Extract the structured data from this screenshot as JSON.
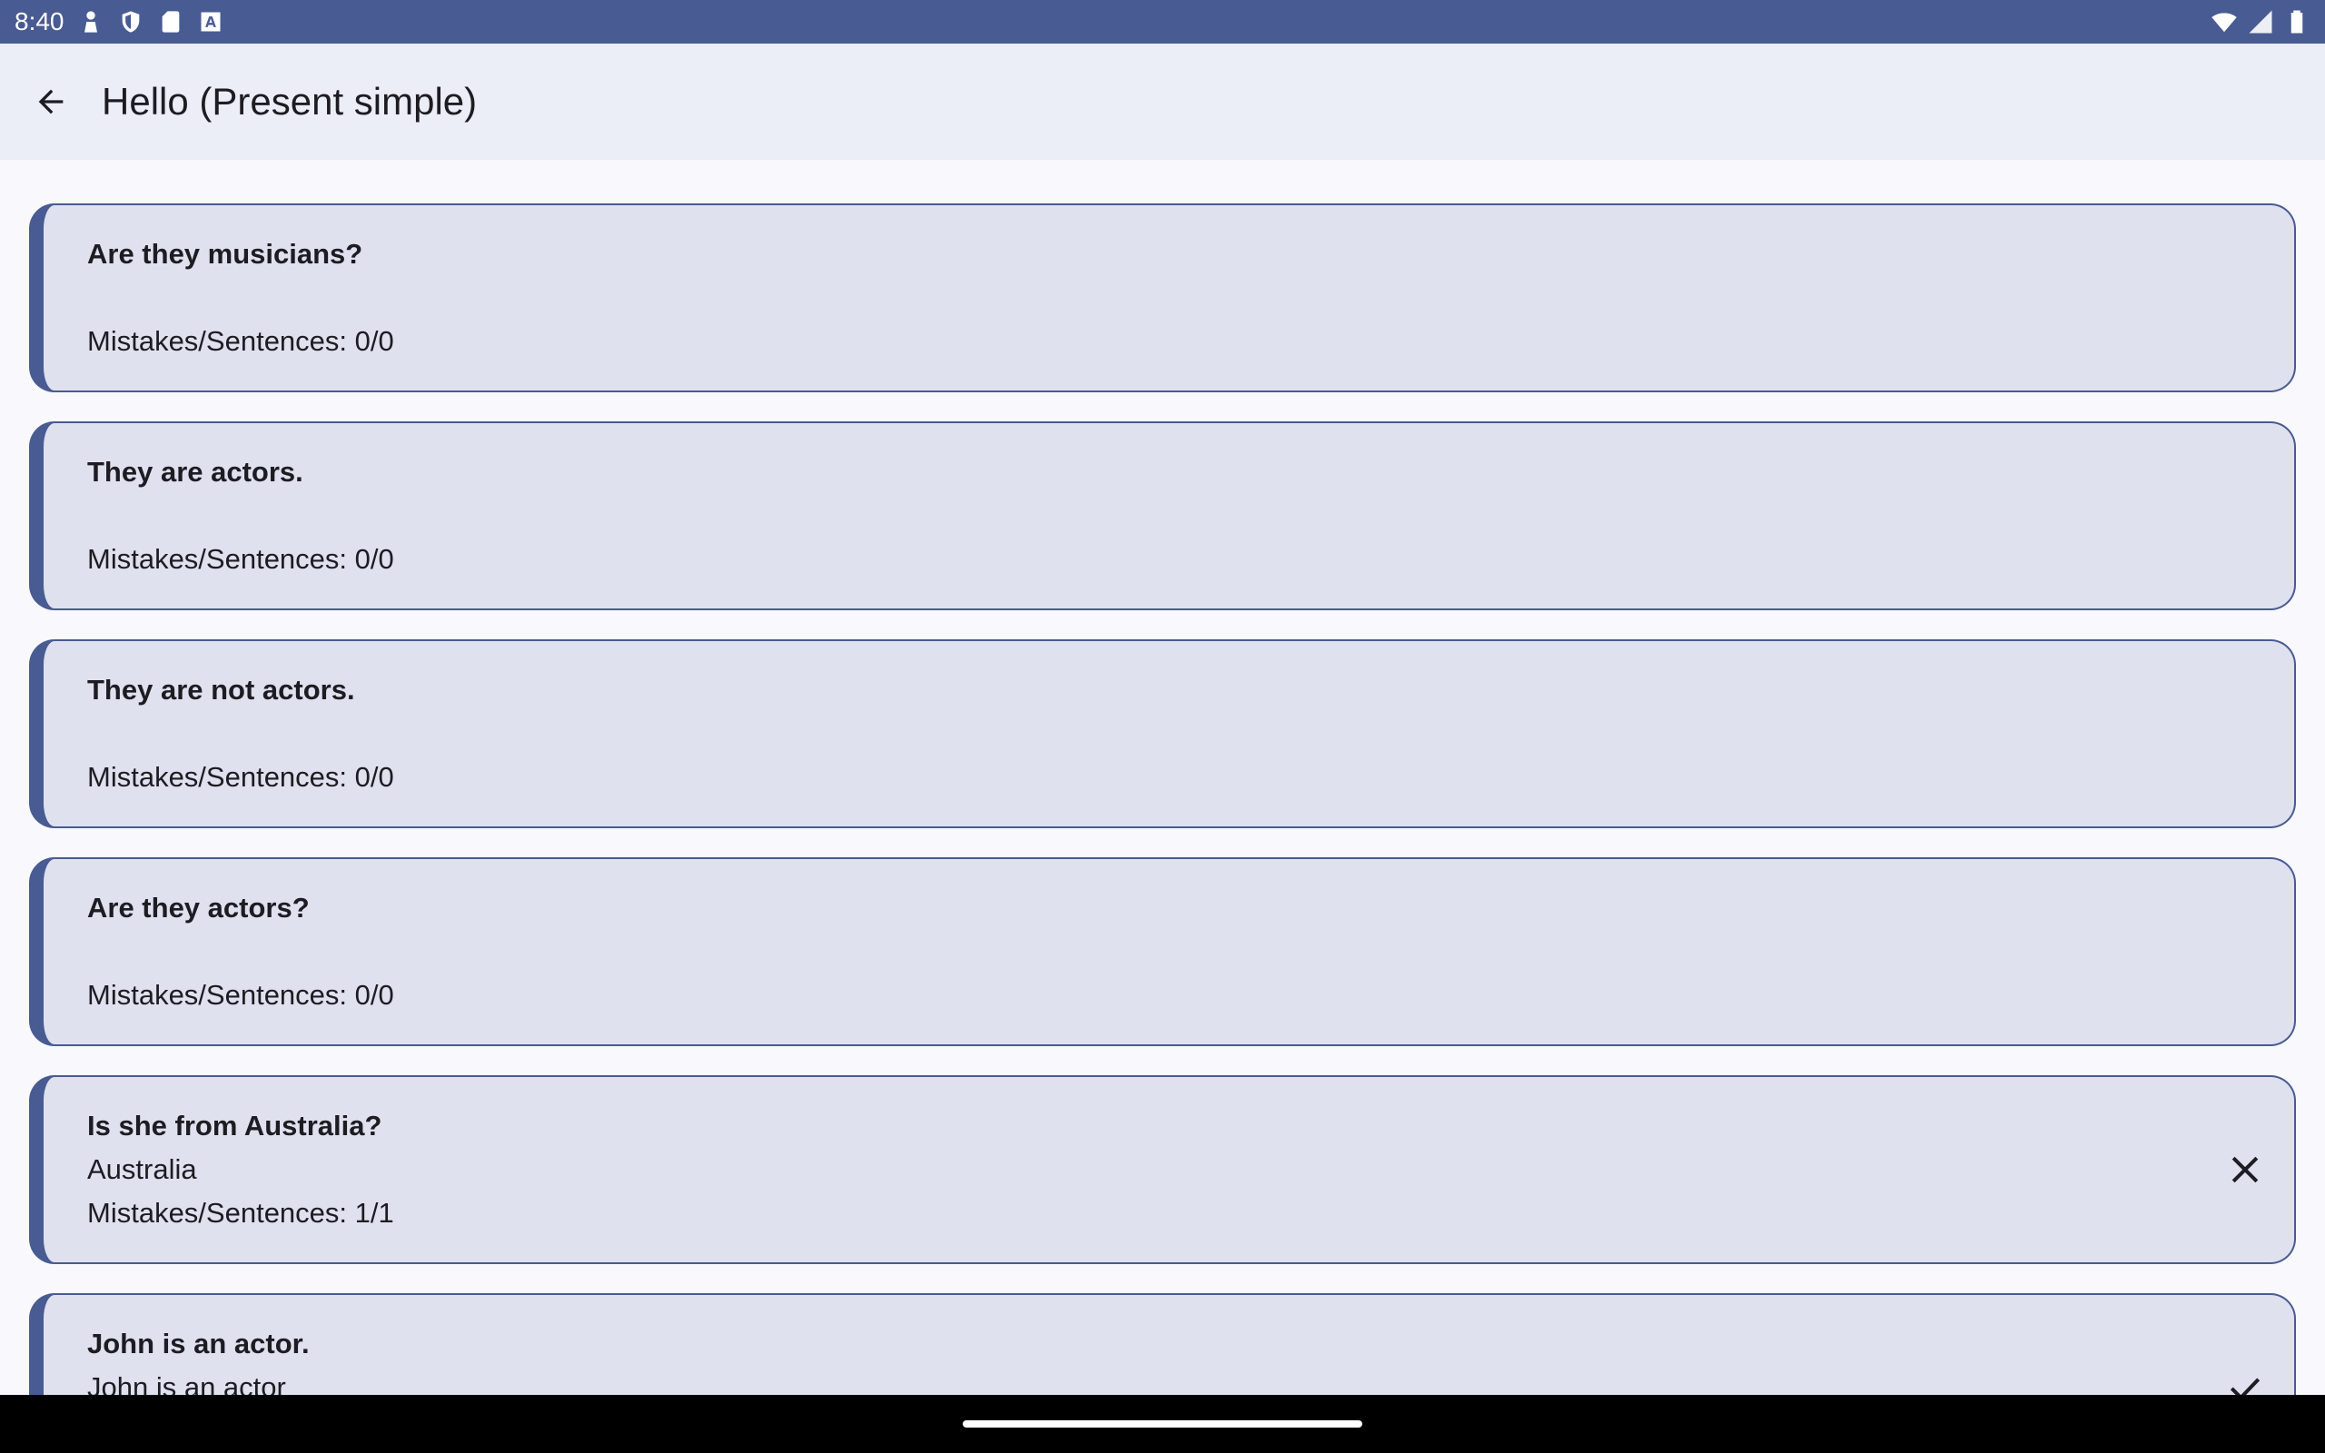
{
  "status_bar": {
    "time": "8:40",
    "left_icons": [
      "notification-person-icon",
      "shield-icon",
      "sd-card-icon",
      "font-a-icon"
    ],
    "right_icons": [
      "wifi-icon",
      "cell-signal-icon",
      "battery-icon"
    ]
  },
  "app_bar": {
    "back_icon": "arrow-back-icon",
    "title": "Hello (Present simple)"
  },
  "cards": [
    {
      "title": "Are they musicians?",
      "answer": "",
      "stats": "Mistakes/Sentences: 0/0",
      "status": "none"
    },
    {
      "title": "They are actors.",
      "answer": "",
      "stats": "Mistakes/Sentences: 0/0",
      "status": "none"
    },
    {
      "title": "They are not actors.",
      "answer": "",
      "stats": "Mistakes/Sentences: 0/0",
      "status": "none"
    },
    {
      "title": "Are they actors?",
      "answer": "",
      "stats": "Mistakes/Sentences: 0/0",
      "status": "none"
    },
    {
      "title": "Is she from Australia?",
      "answer": "Australia",
      "stats": "Mistakes/Sentences: 1/1",
      "status": "close-icon"
    },
    {
      "title": "John is an actor.",
      "answer": "John is an actor",
      "stats": "",
      "status": "check-icon"
    }
  ],
  "colors": {
    "primary": "#485b92",
    "card_background": "#dfe1ee",
    "app_bar_background": "#eceef7",
    "page_background": "#f8f8fd"
  }
}
